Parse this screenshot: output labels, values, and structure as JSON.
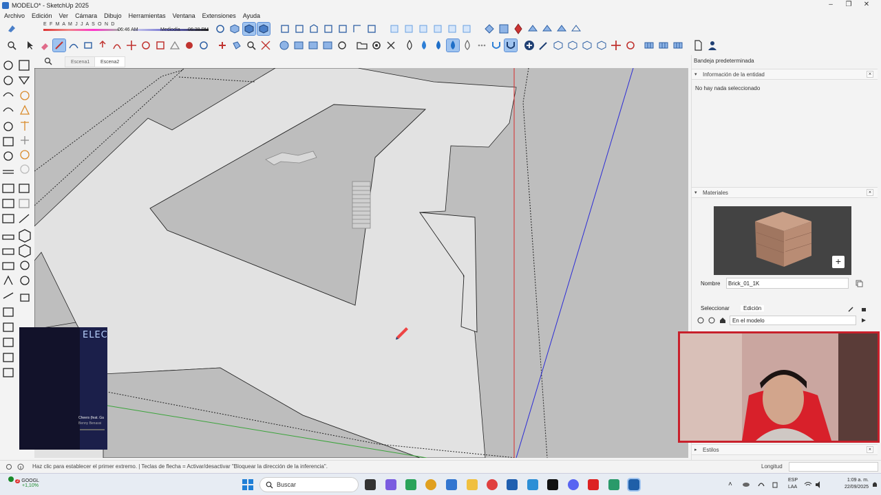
{
  "window": {
    "title": "MODELO* - SketchUp 2025",
    "controls": [
      "–",
      "❐",
      "✕"
    ]
  },
  "menu": [
    "Archivo",
    "Edición",
    "Ver",
    "Cámara",
    "Dibujo",
    "Herramientas",
    "Ventana",
    "Extensiones",
    "Ayuda"
  ],
  "shadow": {
    "months": "E F M A M J J A S O N D",
    "time_start": "06:46 AM",
    "noon": "Mediodía",
    "time_end": "06:38 PM"
  },
  "scenes": {
    "tabs": [
      "Escena1",
      "Escena2"
    ],
    "selected": "Escena2"
  },
  "tray": {
    "title": "Bandeja predeterminada",
    "entity_panel": {
      "title": "Información de la entidad",
      "message": "No hay nada seleccionado"
    },
    "materials_panel": {
      "title": "Materiales",
      "name_label": "Nombre",
      "name_value": "Brick_01_1K",
      "tab_select": "Seleccionar",
      "tab_edit": "Edición",
      "collection": "En el modelo"
    },
    "styles_panel": {
      "title": "Estilos"
    }
  },
  "status": {
    "message": "Haz clic para establecer el primer extremo. | Teclas de flecha = Activar/desactivar \"Bloquear la dirección de la inferencia\".",
    "measurement_label": "Longitud",
    "measurement_value": ""
  },
  "music": {
    "banner": "ELECT",
    "track": "Cheers (feat. Ga",
    "artist": "Benny Benassi"
  },
  "taskbar": {
    "stock_name": "GOOGL",
    "stock_change": "+1,10%",
    "badge": "2",
    "search_placeholder": "Buscar",
    "lang1": "ESP",
    "lang2": "LAA",
    "time": "1:09 a. m.",
    "date": "22/09/2025"
  },
  "colors": {
    "accent_active": "#9fc3ef",
    "red_axis": "#d62b2b",
    "green_axis": "#3aa43a",
    "blue_axis": "#2b2bd6",
    "webcam_frame": "#c8202b"
  }
}
